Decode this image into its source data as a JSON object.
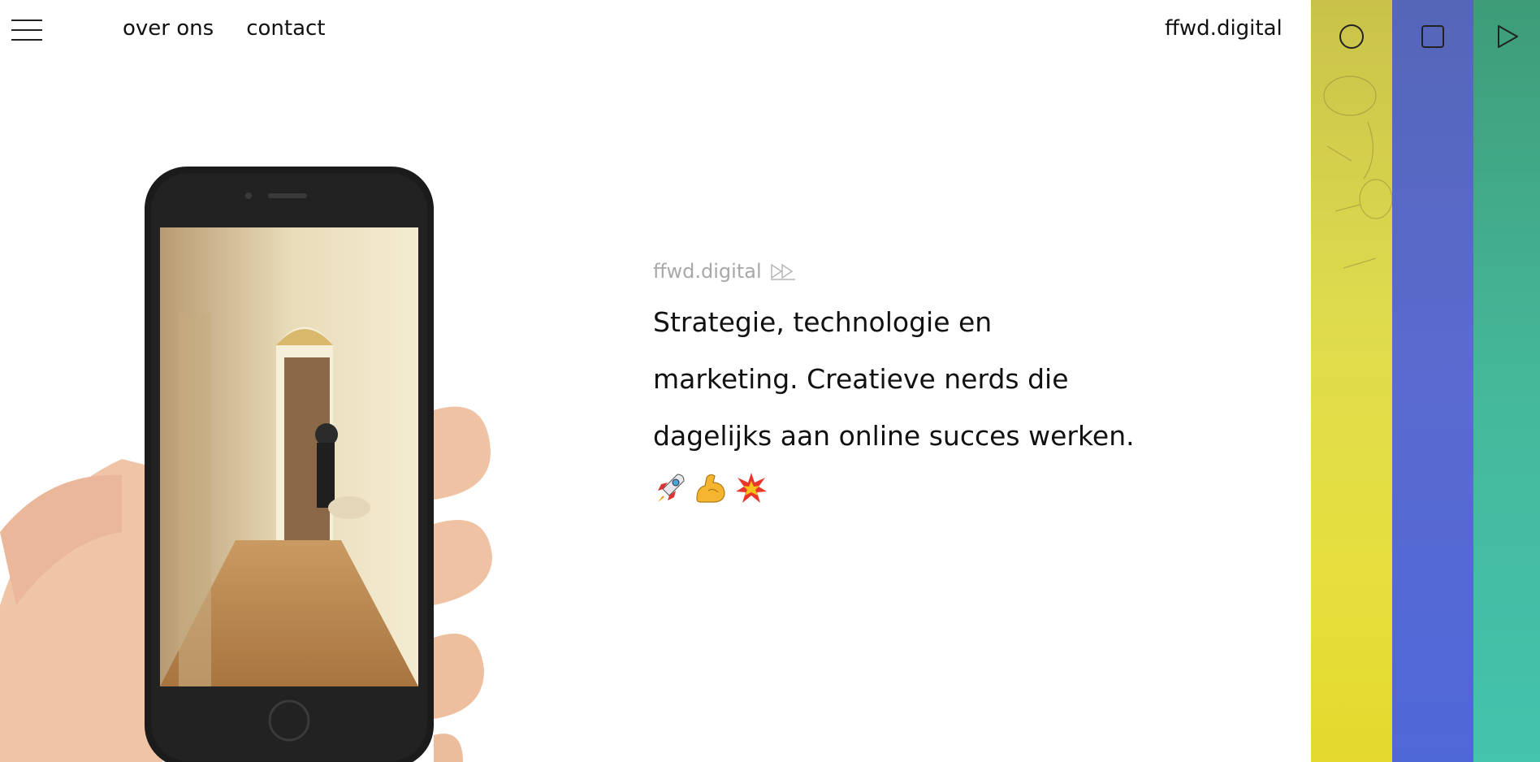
{
  "header": {
    "menu_icon": "hamburger-icon",
    "nav": [
      {
        "label": "over ons"
      },
      {
        "label": "contact"
      }
    ],
    "brand": "ffwd.digital"
  },
  "side_panels": [
    {
      "color": "#dcd64a",
      "icon": "circle-icon"
    },
    {
      "color": "#5566c8",
      "icon": "square-icon"
    },
    {
      "color": "#43b79a",
      "icon": "play-icon"
    }
  ],
  "hero": {
    "eyebrow": "ffwd.digital",
    "eyebrow_icon": "fast-forward-icon",
    "headline_lines": [
      "Strategie, technologie en",
      "marketing. Creatieve nerds die",
      "dagelijks aan online succes werken."
    ],
    "emojis": [
      "rocket-icon",
      "flexed-biceps-icon",
      "collision-icon"
    ]
  }
}
